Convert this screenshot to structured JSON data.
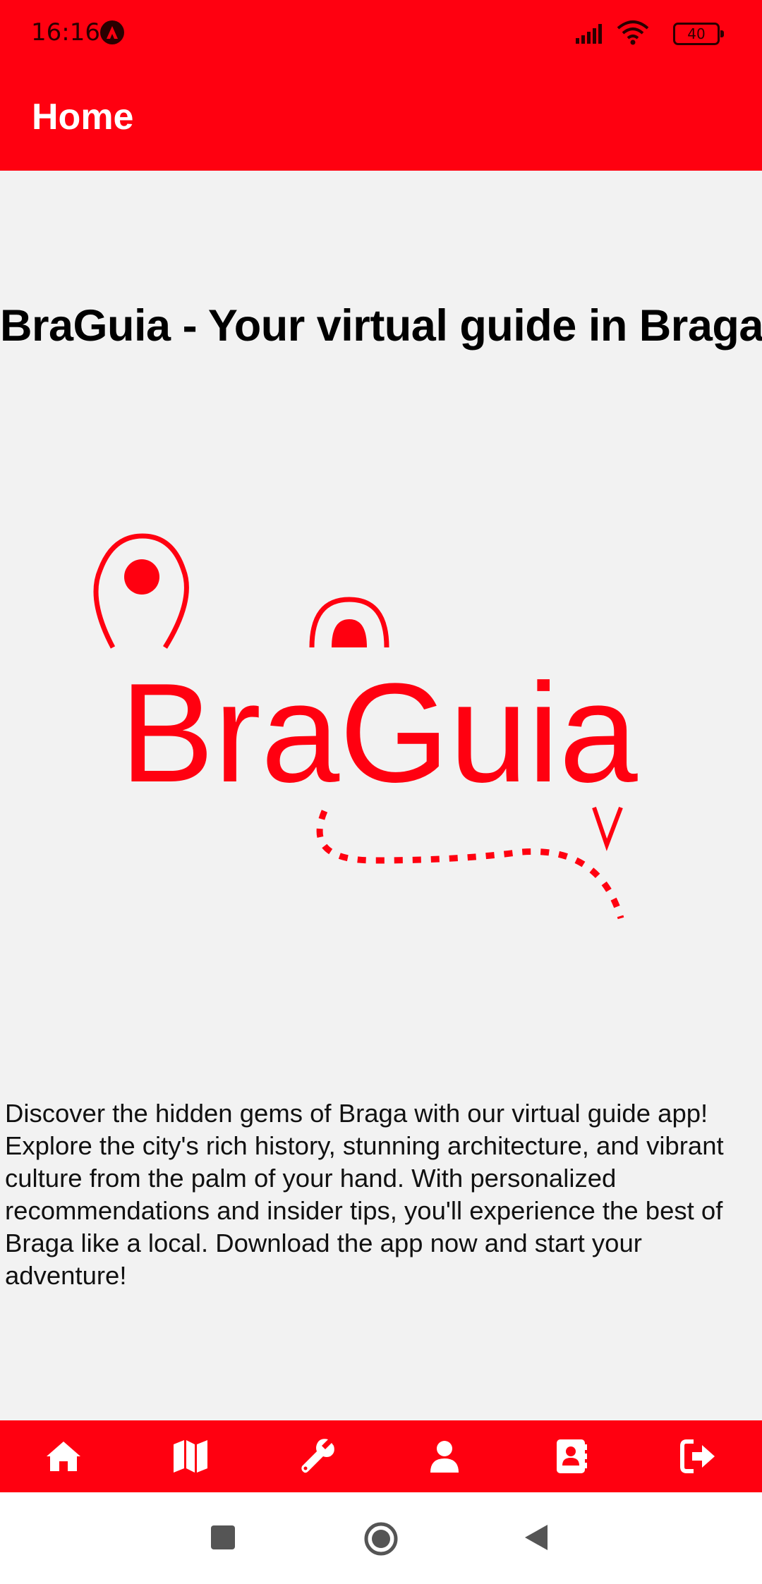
{
  "status_bar": {
    "time": "16:16",
    "battery": "40"
  },
  "app_bar": {
    "title": "Home"
  },
  "main": {
    "heading": "BraGuia - Your virtual guide in Braga",
    "logo_text": "BraGuia",
    "description": "Discover the hidden gems of Braga with our virtual guide app! Explore the city's rich history, stunning architecture, and vibrant culture from the palm of your hand. With personalized recommendations and insider tips, you'll experience the best of Braga like a local. Download the app now and start your adventure!"
  },
  "bottom_nav": {
    "items": [
      {
        "icon": "home-icon"
      },
      {
        "icon": "map-icon"
      },
      {
        "icon": "wrench-icon"
      },
      {
        "icon": "user-icon"
      },
      {
        "icon": "contacts-icon"
      },
      {
        "icon": "logout-icon"
      }
    ]
  },
  "colors": {
    "brand_red": "#ff0010",
    "background": "#f2f2f2"
  }
}
